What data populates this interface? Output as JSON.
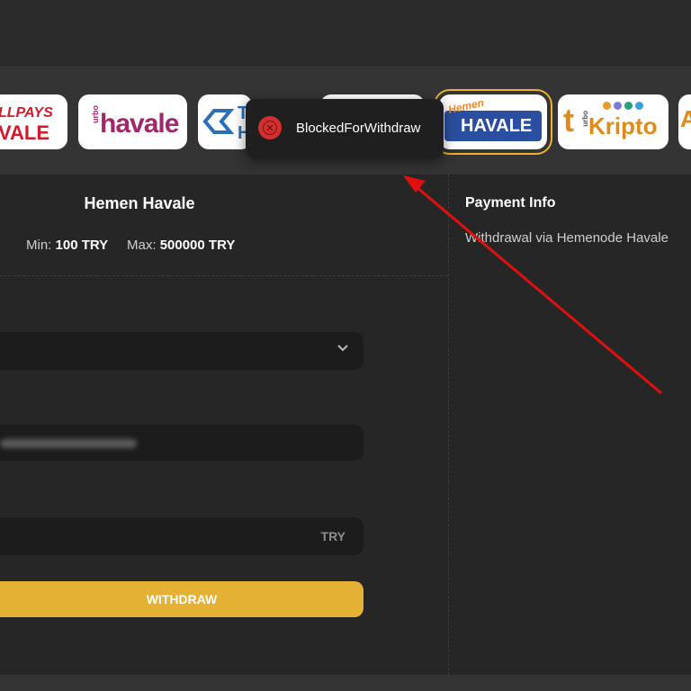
{
  "payment_methods": [
    {
      "id": "allpays",
      "label_top": "LLPAYS",
      "label_bottom": "VALE"
    },
    {
      "id": "turbo-havale",
      "label_small": "urbo",
      "label_main": "havale"
    },
    {
      "id": "turbo-havale-2",
      "label_main": "T",
      "label_bottom": "H"
    },
    {
      "id": "hidden-method"
    },
    {
      "id": "hemen-havale",
      "label_script": "Hemen",
      "label_main": "HAVALE",
      "selected": true
    },
    {
      "id": "turbo-kripto",
      "label_small": "urbo",
      "label_main": "Kripto"
    },
    {
      "id": "partial-method",
      "label_main": "A"
    }
  ],
  "method": {
    "title": "Hemen Havale",
    "min_label": "Min:",
    "min_value": "100 TRY",
    "max_label": "Max:",
    "max_value": "500000 TRY"
  },
  "form": {
    "currency": "TRY",
    "withdraw_label": "WITHDRAW"
  },
  "payment_info": {
    "title": "Payment Info",
    "text": "Withdrawal via Hemenode Havale"
  },
  "toast": {
    "message": "BlockedForWithdraw"
  },
  "colors": {
    "accent": "#e5b134",
    "error": "#d32f2f",
    "annotation_arrow": "#e01010"
  }
}
